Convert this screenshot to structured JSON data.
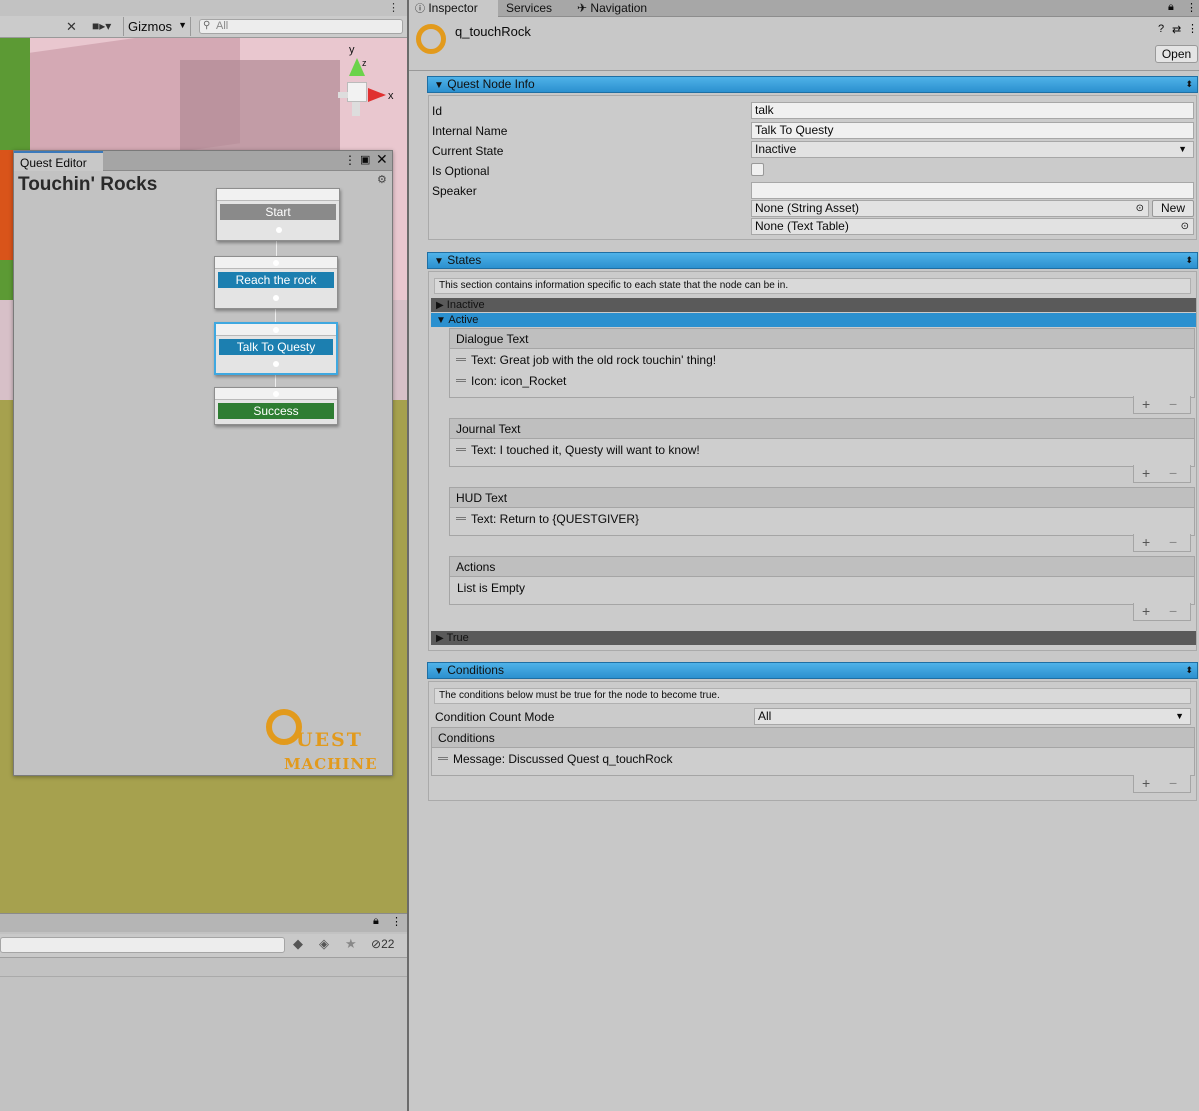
{
  "scene": {
    "gizmos_label": "Gizmos",
    "search_placeholder": "All",
    "axis_y": "y",
    "axis_x": "x",
    "axis_z": "z"
  },
  "quest_editor": {
    "tab_label": "Quest Editor",
    "title": "Touchin' Rocks",
    "nodes": [
      {
        "label": "Start",
        "color": "#8a8a8a"
      },
      {
        "label": "Reach the rock",
        "color": "#1c7fb0"
      },
      {
        "label": "Talk To Questy",
        "color": "#1c7fb0"
      },
      {
        "label": "Success",
        "color": "#2e7d32"
      }
    ],
    "logo_line1": "UEST",
    "logo_line2": "MACHINE"
  },
  "hierarchy": {
    "count": "22"
  },
  "inspector": {
    "tabs": [
      "Inspector",
      "Services",
      "Navigation"
    ],
    "object_name": "q_touchRock",
    "open_button": "Open",
    "quest_node_info": {
      "header": "Quest Node Info",
      "id_label": "Id",
      "id_value": "talk",
      "internal_name_label": "Internal Name",
      "internal_name_value": "Talk To Questy",
      "current_state_label": "Current State",
      "current_state_value": "Inactive",
      "is_optional_label": "Is Optional",
      "speaker_label": "Speaker",
      "speaker_value": "",
      "string_asset": "None (String Asset)",
      "new_button": "New",
      "text_table": "None (Text Table)"
    },
    "states": {
      "header": "States",
      "description": "This section contains information specific to each state that the node can be in.",
      "inactive_label": "Inactive",
      "active_label": "Active",
      "true_label": "True",
      "dialogue_text": {
        "header": "Dialogue Text",
        "rows": [
          "Text: Great job with the old rock touchin' thing!",
          "Icon: icon_Rocket"
        ]
      },
      "journal_text": {
        "header": "Journal Text",
        "rows": [
          "Text: I touched it, Questy will want to know!"
        ]
      },
      "hud_text": {
        "header": "HUD Text",
        "rows": [
          "Text: Return to {QUESTGIVER}"
        ]
      },
      "actions": {
        "header": "Actions",
        "empty": "List is Empty"
      }
    },
    "conditions": {
      "header": "Conditions",
      "description": "The conditions below must be true for the node to become true.",
      "count_mode_label": "Condition Count Mode",
      "count_mode_value": "All",
      "list_header": "Conditions",
      "rows": [
        "Message: Discussed Quest q_touchRock"
      ]
    }
  }
}
